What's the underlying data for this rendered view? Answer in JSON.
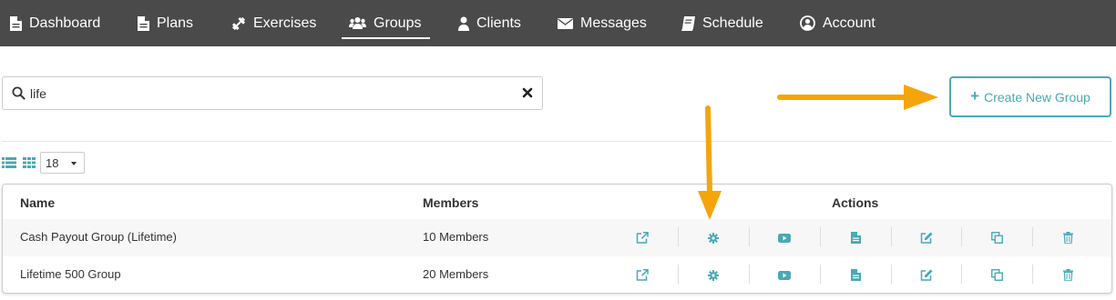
{
  "nav": {
    "items": [
      {
        "label": "Dashboard",
        "icon": "file-icon",
        "active": false
      },
      {
        "label": "Plans",
        "icon": "file-icon",
        "active": false
      },
      {
        "label": "Exercises",
        "icon": "exercises-icon",
        "active": false
      },
      {
        "label": "Groups",
        "icon": "users-icon",
        "active": true
      },
      {
        "label": "Clients",
        "icon": "user-icon",
        "active": false
      },
      {
        "label": "Messages",
        "icon": "envelope-icon",
        "active": false
      },
      {
        "label": "Schedule",
        "icon": "book-icon",
        "active": false
      },
      {
        "label": "Account",
        "icon": "user-circle-icon",
        "active": false
      }
    ]
  },
  "search": {
    "value": "life"
  },
  "create_button": {
    "label": "Create New Group"
  },
  "toolbar": {
    "page_size": "18"
  },
  "table": {
    "headers": {
      "name": "Name",
      "members": "Members",
      "actions": "Actions"
    },
    "rows": [
      {
        "name": "Cash Payout Group (Lifetime)",
        "members": "10 Members"
      },
      {
        "name": "Lifetime 500 Group",
        "members": "20 Members"
      }
    ],
    "action_icons": [
      "external-link-icon",
      "gear-icon",
      "video-icon",
      "document-icon",
      "edit-icon",
      "copy-icon",
      "trash-icon"
    ]
  },
  "colors": {
    "nav_bg": "#4a4a4a",
    "accent": "#49a9b7",
    "annotation_arrow": "#f5a50b"
  }
}
